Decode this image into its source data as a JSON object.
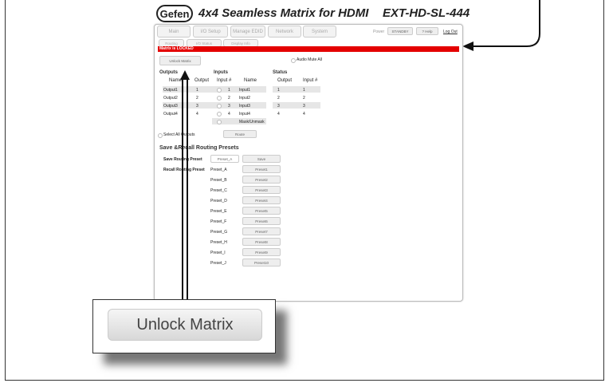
{
  "header": {
    "logo": "Gefen",
    "title": "4x4 Seamless Matrix for HDMI",
    "model": "EXT-HD-SL-444"
  },
  "tabs": [
    "Main",
    "I/O Setup",
    "Manage EDID",
    "Network",
    "System"
  ],
  "top_right": {
    "power_label": "Power",
    "standby": "STANDBY",
    "help": "? Help",
    "logout": "Log Out"
  },
  "subtabs": [
    "Routing",
    "I/O Status",
    "Display Info"
  ],
  "status_banner": "Matrix is LOCKED",
  "unlock_label": "Unlock Matrix",
  "audio_mute": "Audio Mute All",
  "sections": {
    "outputs": "Outputs",
    "inputs": "Inputs",
    "status": "Status"
  },
  "table": {
    "headers": [
      "Name",
      "Output",
      "Input #",
      "Name",
      "Output",
      "Input #"
    ],
    "rows": [
      {
        "name": "Output1",
        "output": "1",
        "input_num": "1",
        "input_name": "Input1",
        "st_output": "1",
        "st_input": "1"
      },
      {
        "name": "Output2",
        "output": "2",
        "input_num": "2",
        "input_name": "Input2",
        "st_output": "2",
        "st_input": "2"
      },
      {
        "name": "Output3",
        "output": "3",
        "input_num": "3",
        "input_name": "Input3",
        "st_output": "3",
        "st_input": "3"
      },
      {
        "name": "Output4",
        "output": "4",
        "input_num": "4",
        "input_name": "Input4",
        "st_output": "4",
        "st_input": "4"
      }
    ],
    "mask": "Mask/Unmask"
  },
  "select_all": "Select All Outputs",
  "route_btn": "Route",
  "presets": {
    "title": "Save &Recall Routing Presets",
    "save_label": "Save Routing Preset",
    "save_field": "Preset_A",
    "save_btn": "Save",
    "recall_label": "Recall Routing Preset",
    "items": [
      {
        "name": "Preset_A",
        "btn": "Preset1"
      },
      {
        "name": "Preset_B",
        "btn": "Preset2"
      },
      {
        "name": "Preset_C",
        "btn": "Preset3"
      },
      {
        "name": "Preset_D",
        "btn": "Preset4"
      },
      {
        "name": "Preset_E",
        "btn": "Preset5"
      },
      {
        "name": "Preset_F",
        "btn": "Preset6"
      },
      {
        "name": "Preset_G",
        "btn": "Preset7"
      },
      {
        "name": "Preset_H",
        "btn": "Preset8"
      },
      {
        "name": "Preset_I",
        "btn": "Preset9"
      },
      {
        "name": "Preset_J",
        "btn": "Preset10"
      }
    ]
  },
  "callout_label": "Unlock Matrix",
  "colors": {
    "banner": "#e40000",
    "row_alt": "#e6e6e6"
  }
}
